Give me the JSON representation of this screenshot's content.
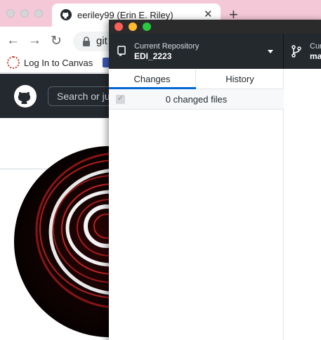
{
  "browser": {
    "tab_title": "eeriley99 (Erin E. Riley)",
    "tab_close_glyph": "✕",
    "new_tab_glyph": "+",
    "back_glyph": "←",
    "forward_glyph": "→",
    "reload_glyph": "↻",
    "address_text": "git",
    "bookmark_label": "Log In to Canvas",
    "search_placeholder": "Search or ju"
  },
  "desktop": {
    "repo_label": "Current Repository",
    "repo_name": "EDI_2223",
    "branch_label": "Cur",
    "branch_name": "ma",
    "tabs": {
      "changes": "Changes",
      "history": "History"
    },
    "changed_files": "0 changed files",
    "check_glyph": "✓"
  },
  "colors": {
    "accent_blue": "#0366d6",
    "desktop_toolbar": "#24292e",
    "github_header": "#24292f",
    "chrome_tabbar": "#f5c8d7",
    "traffic_close": "#fe5f57",
    "traffic_min": "#febc2e",
    "traffic_max": "#28c840"
  },
  "icons": [
    "github-favicon-icon",
    "lock-icon",
    "canvas-logo-icon",
    "bookmark-icon",
    "github-octocat-icon",
    "repo-icon",
    "caret-down-icon",
    "branch-icon",
    "checkbox-icon"
  ]
}
